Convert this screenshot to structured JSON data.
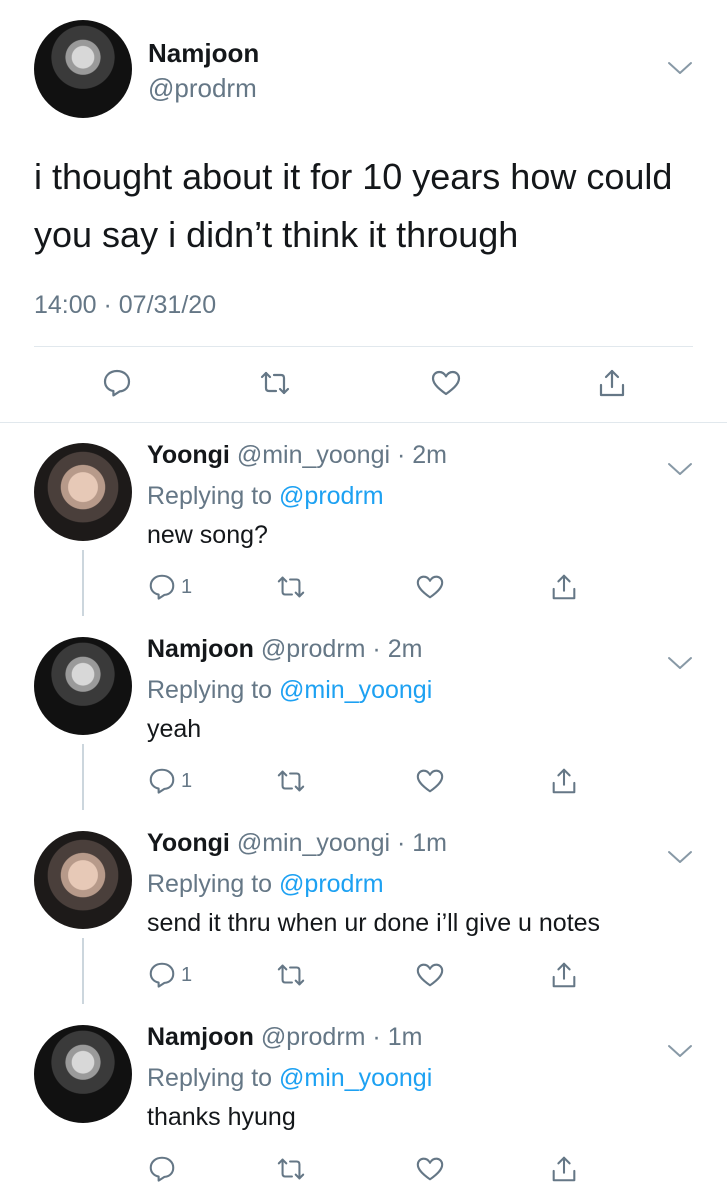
{
  "main_tweet": {
    "name": "Namjoon",
    "handle": "@prodrm",
    "text": "i thought about it for 10 years how could you say i didn’t think it through",
    "time": "14:00 · 07/31/20"
  },
  "replies": [
    {
      "name": "Yoongi",
      "meta": "@min_yoongi · 2m",
      "replying_prefix": "Replying to ",
      "replying_to": "@prodrm",
      "text": "new song?",
      "reply_count": "1"
    },
    {
      "name": "Namjoon",
      "meta": "@prodrm · 2m",
      "replying_prefix": "Replying to ",
      "replying_to": "@min_yoongi",
      "text": "yeah",
      "reply_count": "1"
    },
    {
      "name": "Yoongi",
      "meta": "@min_yoongi · 1m",
      "replying_prefix": "Replying to ",
      "replying_to": "@prodrm",
      "text": "send it thru when ur done i’ll give u notes",
      "reply_count": "1"
    },
    {
      "name": "Namjoon",
      "meta": "@prodrm · 1m",
      "replying_prefix": "Replying to ",
      "replying_to": "@min_yoongi",
      "text": "thanks hyung",
      "reply_count": ""
    }
  ],
  "colors": {
    "text": "#14171a",
    "secondary": "#657786",
    "link": "#1da1f2",
    "divider": "#e1e8ed"
  },
  "icons": [
    "reply-icon",
    "retweet-icon",
    "like-icon",
    "share-icon",
    "chevron-down-icon"
  ]
}
